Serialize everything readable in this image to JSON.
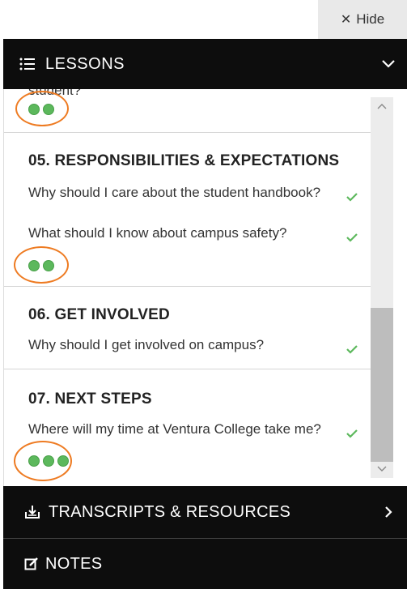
{
  "hide_bar": {
    "label": "Hide",
    "icon": "close-icon"
  },
  "lessons_header": {
    "label": "LESSONS",
    "icons": [
      "list-icon",
      "chevron-down-icon"
    ]
  },
  "top_fragment": {
    "text": "student?",
    "dots": 2
  },
  "sections": [
    {
      "title": "05. RESPONSIBILITIES & EXPECTATIONS",
      "lessons": [
        {
          "text": "Why should I care about the student handbook?",
          "completed": true
        },
        {
          "text": "What should I know about campus safety?",
          "completed": true
        }
      ],
      "dots": 2
    },
    {
      "title": "06. GET INVOLVED",
      "lessons": [
        {
          "text": "Why should I get involved on campus?",
          "completed": true
        }
      ],
      "dots": 0
    },
    {
      "title": "07. NEXT STEPS",
      "lessons": [
        {
          "text": "Where will my time at Ventura College take me?",
          "completed": true
        }
      ],
      "dots": 3
    }
  ],
  "transcripts_bar": {
    "label": "TRANSCRIPTS & RESOURCES",
    "icons": [
      "download-tray-icon",
      "chevron-right-icon"
    ]
  },
  "notes_bar": {
    "label": "NOTES",
    "icons": [
      "edit-note-icon"
    ]
  },
  "colors": {
    "dark_bar": "#0d0d0d",
    "check_green": "#5cb85c",
    "dot_green": "#5cb85c",
    "annotation_orange": "#ee7b22",
    "hide_bg": "#e9e9e9"
  }
}
